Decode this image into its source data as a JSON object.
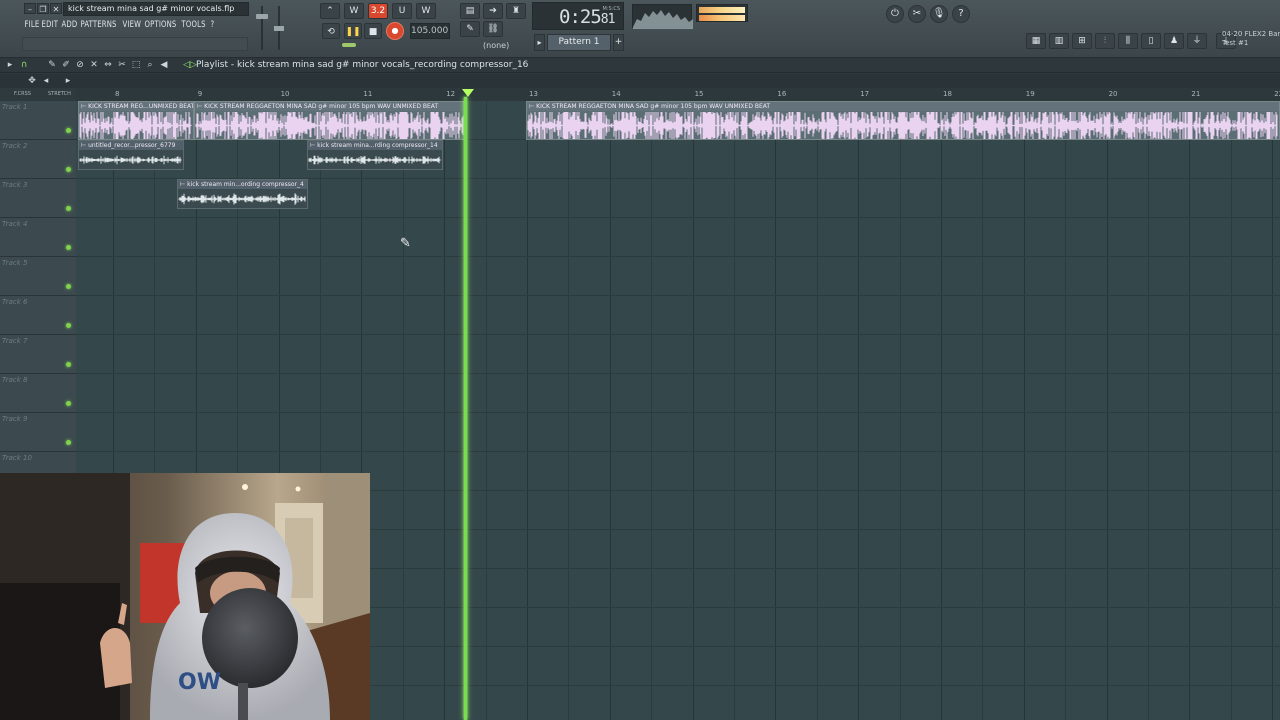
{
  "window": {
    "title": "kick stream mina sad g# minor vocals.flp"
  },
  "menu": [
    "FILE",
    "EDIT",
    "ADD",
    "PATTERNS",
    "VIEW",
    "OPTIONS",
    "TOOLS",
    "?"
  ],
  "transport": {
    "tempo": "105.000",
    "time": "0:25",
    "time_sub": "81",
    "time_unit": "M:S:CS",
    "snap": "(none)",
    "pattern": "Pattern 1",
    "counter_badge": "3.2"
  },
  "news": {
    "line1": "04-20  FLEX2 Bar",
    "line2": "Test #1"
  },
  "playlist": {
    "title": "Playlist - kick stream mina sad g# minor vocals_recording compressor_16",
    "header_labels": [
      "F.CRSS",
      "STRETCH"
    ],
    "ruler": [
      "8",
      "9",
      "10",
      "11",
      "12",
      "13",
      "14",
      "15",
      "16",
      "17",
      "18",
      "19",
      "20",
      "21",
      "22"
    ],
    "tracks": [
      "Track 1",
      "Track 2",
      "Track 3",
      "Track 4",
      "Track 5",
      "Track 6",
      "Track 7",
      "Track 8",
      "Track 9",
      "Track 10"
    ],
    "clips": [
      {
        "label": "KICK STREAM REG...UNMIXED BEAT"
      },
      {
        "label": "KICK STREAM REGGAETON MINA SAD g# minor 105 bpm WAV UNMIXED BEAT"
      },
      {
        "label": "KICK STREAM REGGAETON MINA SAD g# minor 105 bpm WAV UNMIXED BEAT"
      },
      {
        "label": "untitled_recor...pressor_6779"
      },
      {
        "label": "kick stream mina...rding compressor_14"
      },
      {
        "label": "kick stream min...ording compressor_4"
      }
    ]
  },
  "colors": {
    "playhead": "#74e04a",
    "grid_bg": "#34474a",
    "record": "#d9472f",
    "track_led": "#7fd34e"
  }
}
